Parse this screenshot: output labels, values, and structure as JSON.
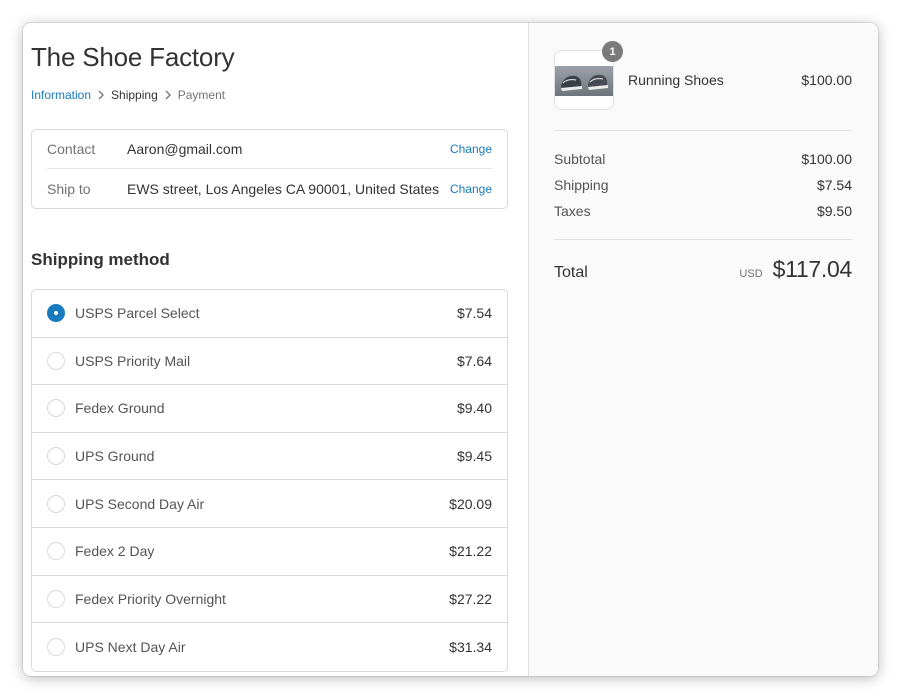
{
  "store": {
    "title": "The Shoe Factory"
  },
  "breadcrumb": {
    "items": [
      {
        "label": "Information"
      },
      {
        "label": "Shipping"
      },
      {
        "label": "Payment"
      }
    ]
  },
  "review": {
    "contact": {
      "label": "Contact",
      "value": "Aaron@gmail.com",
      "change": "Change"
    },
    "ship_to": {
      "label": "Ship to",
      "value": "EWS street, Los Angeles CA 90001, United States",
      "change": "Change"
    }
  },
  "shipping": {
    "title": "Shipping method",
    "methods": [
      {
        "name": "USPS Parcel Select",
        "price": "$7.54",
        "selected": true
      },
      {
        "name": "USPS Priority Mail",
        "price": "$7.64",
        "selected": false
      },
      {
        "name": "Fedex Ground",
        "price": "$9.40",
        "selected": false
      },
      {
        "name": "UPS Ground",
        "price": "$9.45",
        "selected": false
      },
      {
        "name": "UPS Second Day Air",
        "price": "$20.09",
        "selected": false
      },
      {
        "name": "Fedex 2 Day",
        "price": "$21.22",
        "selected": false
      },
      {
        "name": "Fedex Priority Overnight",
        "price": "$27.22",
        "selected": false
      },
      {
        "name": "UPS Next Day Air",
        "price": "$31.34",
        "selected": false
      }
    ]
  },
  "order": {
    "product": {
      "name": "Running Shoes",
      "price": "$100.00",
      "quantity": "1",
      "image_icon": "running-shoes-image"
    },
    "subtotal": {
      "label": "Subtotal",
      "value": "$100.00"
    },
    "shipping": {
      "label": "Shipping",
      "value": "$7.54"
    },
    "taxes": {
      "label": "Taxes",
      "value": "$9.50"
    },
    "total": {
      "label": "Total",
      "currency": "USD",
      "value": "$117.04"
    }
  },
  "colors": {
    "accent": "#197bbd",
    "sidebar_background": "#fafafa",
    "badge": "#7a7a7a"
  }
}
